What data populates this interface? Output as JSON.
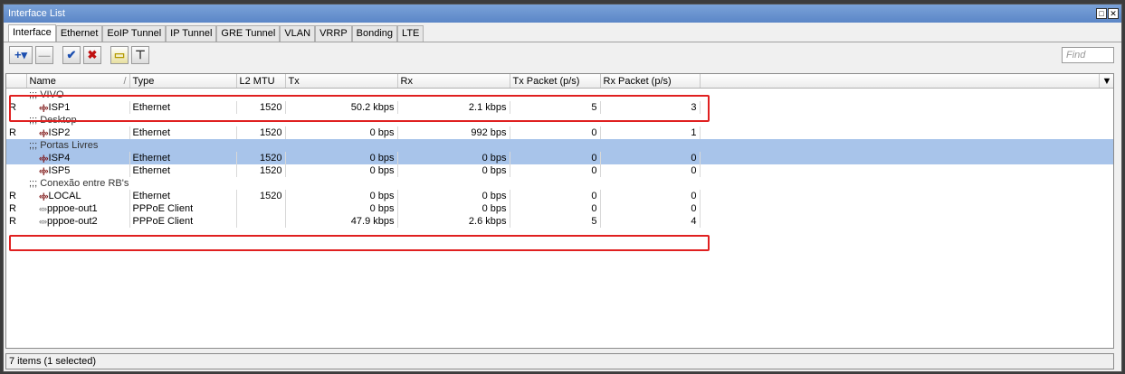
{
  "window": {
    "title": "Interface List",
    "restore_glyph": "□",
    "close_glyph": "✕"
  },
  "tabs": [
    "Interface",
    "Ethernet",
    "EoIP Tunnel",
    "IP Tunnel",
    "GRE Tunnel",
    "VLAN",
    "VRRP",
    "Bonding",
    "LTE"
  ],
  "toolbar": {
    "add": "+▾",
    "remove": "—",
    "enable": "✔",
    "disable": "✖",
    "comment": "▭",
    "filter": "⊤",
    "find_placeholder": "Find"
  },
  "columns": [
    "",
    "Name",
    "Type",
    "L2 MTU",
    "Tx",
    "Rx",
    "Tx Packet (p/s)",
    "Rx Packet (p/s)"
  ],
  "sort_marker": "/",
  "dropdown_glyph": "▼",
  "rows": [
    {
      "kind": "group",
      "text": ";;; VIVO"
    },
    {
      "kind": "iface",
      "flag": "R",
      "icon": "«|»",
      "name": "ISP1",
      "type": "Ethernet",
      "mtu": "1520",
      "tx": "50.2 kbps",
      "rx": "2.1 kbps",
      "txp": "5",
      "rxp": "3"
    },
    {
      "kind": "group",
      "text": ";;; Desktop"
    },
    {
      "kind": "iface",
      "flag": "R",
      "icon": "«|»",
      "name": "ISP2",
      "type": "Ethernet",
      "mtu": "1520",
      "tx": "0 bps",
      "rx": "992 bps",
      "txp": "0",
      "rxp": "1"
    },
    {
      "kind": "group",
      "text": ";;; Portas Livres",
      "selected": true
    },
    {
      "kind": "iface",
      "flag": "",
      "icon": "«|»",
      "name": "ISP4",
      "type": "Ethernet",
      "mtu": "1520",
      "tx": "0 bps",
      "rx": "0 bps",
      "txp": "0",
      "rxp": "0",
      "selected": true
    },
    {
      "kind": "iface",
      "flag": "",
      "icon": "«|»",
      "name": "ISP5",
      "type": "Ethernet",
      "mtu": "1520",
      "tx": "0 bps",
      "rx": "0 bps",
      "txp": "0",
      "rxp": "0"
    },
    {
      "kind": "group",
      "text": ";;; Conexão entre RB's"
    },
    {
      "kind": "iface",
      "flag": "R",
      "icon": "«|»",
      "name": "LOCAL",
      "type": "Ethernet",
      "mtu": "1520",
      "tx": "0 bps",
      "rx": "0 bps",
      "txp": "0",
      "rxp": "0"
    },
    {
      "kind": "iface",
      "flag": "R",
      "icon": "«»",
      "name": "pppoe-out1",
      "type": "PPPoE Client",
      "mtu": "",
      "tx": "0 bps",
      "rx": "0 bps",
      "txp": "0",
      "rxp": "0"
    },
    {
      "kind": "iface",
      "flag": "R",
      "icon": "«»",
      "name": "pppoe-out2",
      "type": "PPPoE Client",
      "mtu": "",
      "tx": "47.9 kbps",
      "rx": "2.6 kbps",
      "txp": "5",
      "rxp": "4"
    }
  ],
  "status": "7 items (1 selected)",
  "colors": {
    "selection": "#a8c4ea",
    "highlight": "#e02020",
    "titlebar": "#5b86c7"
  }
}
